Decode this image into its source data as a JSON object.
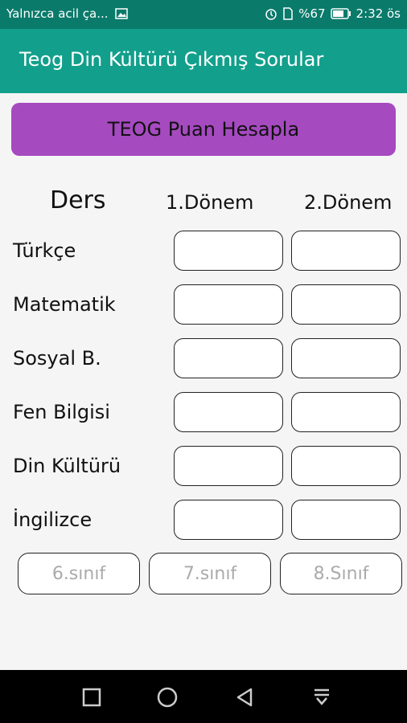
{
  "status_bar": {
    "notification_text": "Yalnızca acil ça...",
    "battery_text": "%67",
    "time": "2:32 ös",
    "icons": [
      "image-icon",
      "alarm-icon",
      "sim-icon",
      "battery-icon"
    ]
  },
  "app_bar": {
    "title": "Teog Din Kültürü Çıkmış Sorular"
  },
  "calculate_button": {
    "label": "TEOG Puan Hesapla"
  },
  "table": {
    "headers": {
      "subject": "Ders",
      "term1": "1.Dönem",
      "term2": "2.Dönem"
    },
    "rows": [
      {
        "subject": "Türkçe",
        "term1": "",
        "term2": ""
      },
      {
        "subject": "Matematik",
        "term1": "",
        "term2": ""
      },
      {
        "subject": "Sosyal B.",
        "term1": "",
        "term2": ""
      },
      {
        "subject": "Fen Bilgisi",
        "term1": "",
        "term2": ""
      },
      {
        "subject": "Din Kültürü",
        "term1": "",
        "term2": ""
      },
      {
        "subject": "İngilizce",
        "term1": "",
        "term2": ""
      }
    ]
  },
  "grade_buttons": [
    "6.sınıf",
    "7.sınıf",
    "8.Sınıf"
  ],
  "nav_bar": {
    "icons": [
      "recents-square-icon",
      "home-circle-icon",
      "back-triangle-icon",
      "notification-pull-icon"
    ]
  },
  "colors": {
    "status_bar": "#0a7a6b",
    "app_bar": "#12a08c",
    "accent_button": "#a64ac0"
  }
}
